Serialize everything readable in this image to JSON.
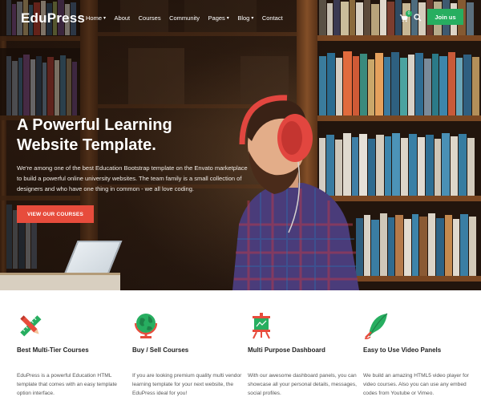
{
  "brand": {
    "name": "EduPress"
  },
  "nav": {
    "items": [
      {
        "label": "Home",
        "has_dropdown": true
      },
      {
        "label": "About",
        "has_dropdown": false
      },
      {
        "label": "Courses",
        "has_dropdown": false
      },
      {
        "label": "Community",
        "has_dropdown": false
      },
      {
        "label": "Pages",
        "has_dropdown": true
      },
      {
        "label": "Blog",
        "has_dropdown": true
      },
      {
        "label": "Contact",
        "has_dropdown": false
      }
    ],
    "cart_icon": "shopping-cart-icon",
    "cart_count": "0",
    "search_icon": "search-icon",
    "join_label": "Join us"
  },
  "hero": {
    "title": "A Powerful Learning Website Template.",
    "description": "We're among one of the best Education Bootstrap template on the Envato marketplace to build a powerful online university websites. The team family is a small collection of designers and who have one thing in common - we all love coding.",
    "cta_label": "VIEW OUR COURSES"
  },
  "features": [
    {
      "icon": "ruler-pencil-icon",
      "title": "Best Multi-Tier Courses",
      "description": "EduPress is a powerful Education HTML template that comes with an easy template option interface."
    },
    {
      "icon": "globe-icon",
      "title": "Buy / Sell Courses",
      "description": "If you are looking premium quality multi vendor learning template for your next website, the EduPress ideal for you!"
    },
    {
      "icon": "presentation-board-icon",
      "title": "Multi Purpose Dashboard",
      "description": "With our awesome dashboard panels, you can showcase all your personal details, messages, social profiles."
    },
    {
      "icon": "quill-pen-icon",
      "title": "Easy to Use Video Panels",
      "description": "We build an amazing HTML5 video player for video courses. Also you can use any embed codes from Youtube or Vimeo."
    }
  ],
  "colors": {
    "accent_green": "#27ae60",
    "cta_red": "#e74c3c",
    "icon_red": "#e74c3c",
    "icon_green": "#27ae60"
  }
}
